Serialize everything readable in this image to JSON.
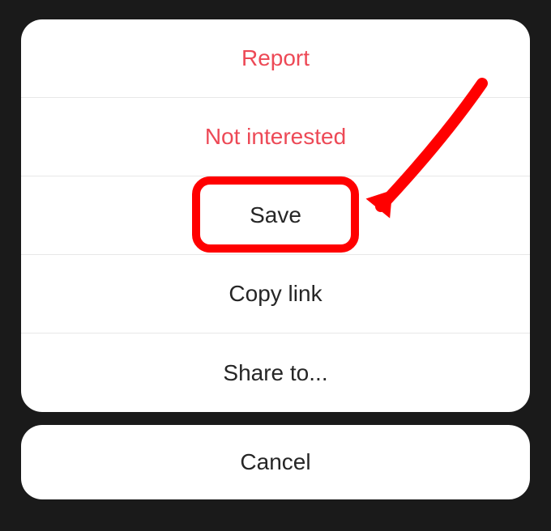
{
  "actions": {
    "report": "Report",
    "not_interested": "Not interested",
    "save": "Save",
    "copy_link": "Copy link",
    "share_to": "Share to..."
  },
  "cancel": "Cancel",
  "colors": {
    "destructive": "#ed4956",
    "highlight": "#ff0000"
  }
}
